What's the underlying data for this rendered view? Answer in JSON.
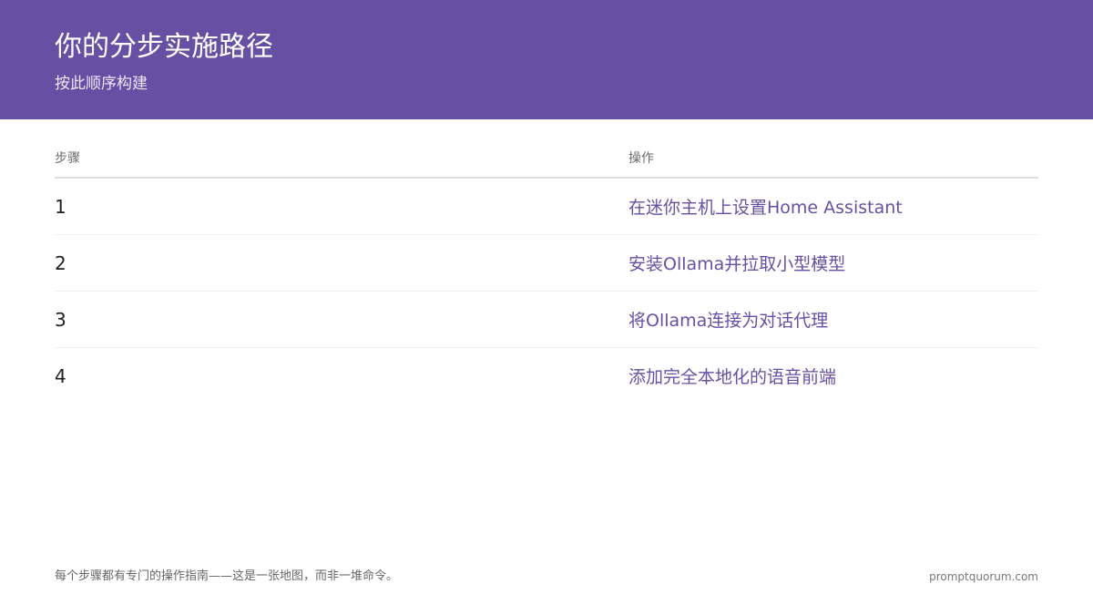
{
  "header": {
    "title": "你的分步实施路径",
    "subtitle": "按此顺序构建",
    "background_color": "#6750a4"
  },
  "table": {
    "columns": [
      "步骤",
      "操作"
    ],
    "rows": [
      {
        "step": "1",
        "action": "在迷你主机上设置Home Assistant"
      },
      {
        "step": "2",
        "action": "安装Ollama并拉取小型模型"
      },
      {
        "step": "3",
        "action": "将Ollama连接为对话代理"
      },
      {
        "step": "4",
        "action": "添加完全本地化的语音前端"
      }
    ],
    "action_color": "#6750a4"
  },
  "footer": {
    "note": "每个步骤都有专门的操作指南——这是一张地图，而非一堆命令。",
    "brand": "promptquorum.com"
  }
}
